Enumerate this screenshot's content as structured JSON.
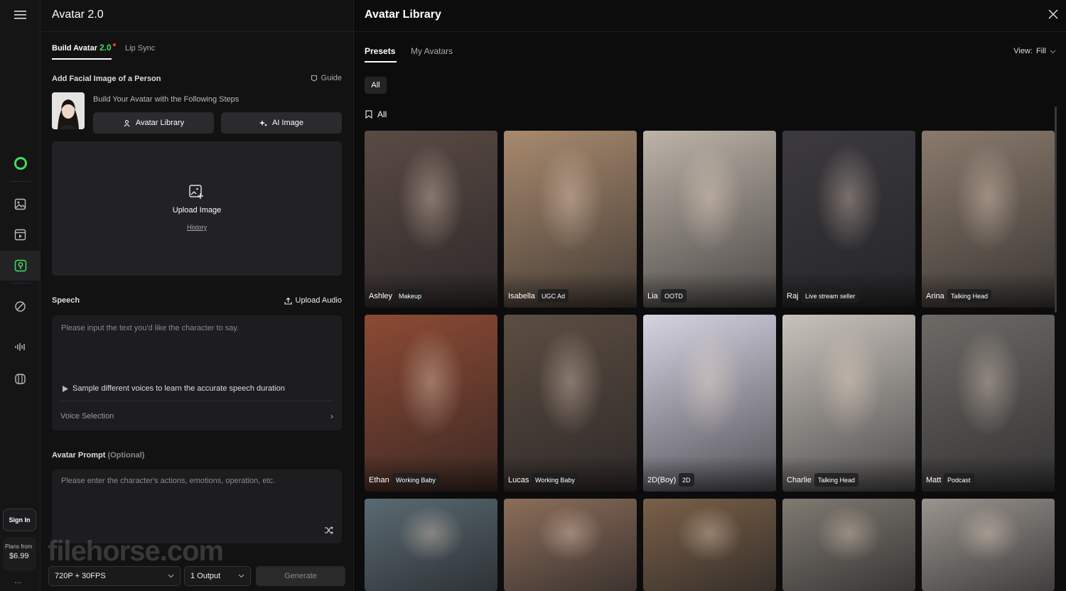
{
  "app": {
    "title": "Avatar 2.0"
  },
  "rail": {
    "sign_in": "Sign In",
    "plans_label": "Plans from",
    "plans_price": "$6.99",
    "more": "..."
  },
  "tabs": {
    "build": "Build Avatar",
    "build_version": "2.0",
    "lip_sync": "Lip Sync"
  },
  "facial": {
    "title": "Add Facial Image of a Person",
    "guide": "Guide",
    "steps_text": "Build Your Avatar with the Following Steps",
    "avatar_library_btn": "Avatar Library",
    "ai_image_btn": "AI Image"
  },
  "upload": {
    "label": "Upload Image",
    "history": "History"
  },
  "speech": {
    "title": "Speech",
    "upload_audio": "Upload Audio",
    "placeholder": "Please input the text you'd like the character to say.",
    "sample": "Sample different voices to learn the accurate speech duration",
    "voice_selection": "Voice Selection"
  },
  "prompt": {
    "title": "Avatar Prompt",
    "optional": "(Optional)",
    "placeholder": "Please enter the character's actions, emotions, operation, etc."
  },
  "footer": {
    "resolution": "720P + 30FPS",
    "output": "1 Output",
    "generate": "Generate"
  },
  "watermark": "filehorse.com",
  "library": {
    "title": "Avatar Library",
    "tabs": [
      "Presets",
      "My Avatars"
    ],
    "view_label": "View:",
    "view_value": "Fill",
    "filter_chip": "All",
    "section": "All",
    "cards": [
      {
        "name": "Ashley",
        "tag": "Makeup",
        "color": "#5a4a44"
      },
      {
        "name": "Isabella",
        "tag": "UGC Ad",
        "color": "#a88a6e"
      },
      {
        "name": "Lia",
        "tag": "OOTD",
        "color": "#bdb3a8"
      },
      {
        "name": "Raj",
        "tag": "Live stream seller",
        "color": "#3c3a3e"
      },
      {
        "name": "Arina",
        "tag": "Talking Head",
        "color": "#8a7a6c"
      },
      {
        "name": "Ethan",
        "tag": "Working Baby",
        "color": "#8c4a34"
      },
      {
        "name": "Lucas",
        "tag": "Working Baby",
        "color": "#5c4d42"
      },
      {
        "name": "2D(Boy)",
        "tag": "2D",
        "color": "#d6d4e2"
      },
      {
        "name": "Charlie",
        "tag": "Talking Head",
        "color": "#c9c3bc"
      },
      {
        "name": "Matt",
        "tag": "Podcast",
        "color": "#6d6a66"
      },
      {
        "name": "",
        "tag": "",
        "color": "#5a6a72"
      },
      {
        "name": "",
        "tag": "",
        "color": "#8c6e5a"
      },
      {
        "name": "",
        "tag": "",
        "color": "#7a6048"
      },
      {
        "name": "",
        "tag": "",
        "color": "#807a72"
      },
      {
        "name": "",
        "tag": "",
        "color": "#9a948e"
      }
    ]
  }
}
